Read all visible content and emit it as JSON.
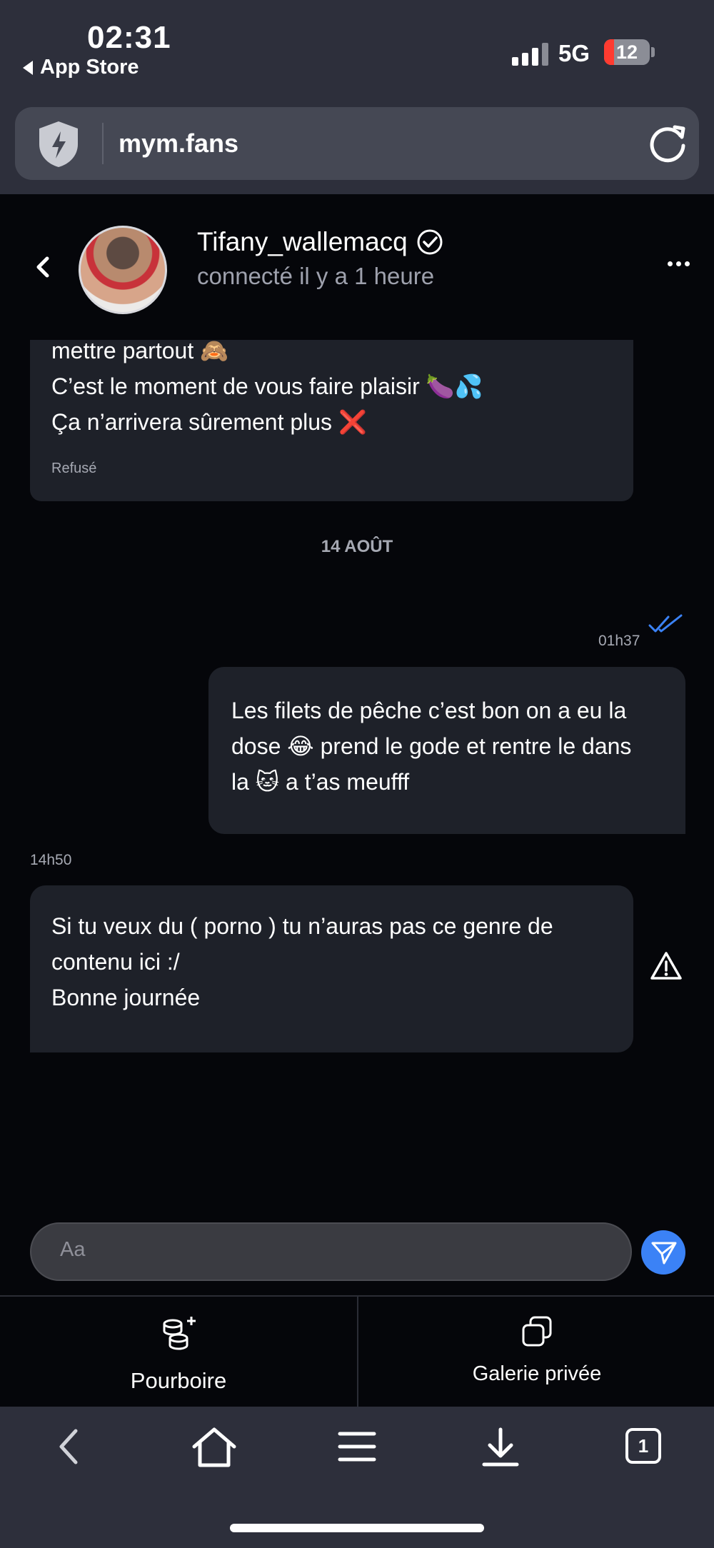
{
  "status_bar": {
    "time": "02:31",
    "back_app": "App Store",
    "network": "5G",
    "battery": "12",
    "battery_color": "#ff3b30"
  },
  "browser": {
    "url": "mym.fans",
    "icons": [
      "shield-icon",
      "reload-icon"
    ]
  },
  "chat": {
    "contact_name": "Tifany_wallemacq",
    "contact_status": "connecté il y a 1 heure",
    "verified": true,
    "messages": {
      "prev": {
        "line1": "mettre partout 🙈",
        "line2": "C’est le moment de vous faire plaisir 🍆💦",
        "line3": "Ça n’arrivera sûrement plus ❌",
        "label": "Refusé"
      },
      "date_separator": "14 AOÛT",
      "outgoing": {
        "time": "01h37",
        "line1": "Les filets de pêche c’est bon on a eu la",
        "line2": "dose 😂 prend le gode et rentre le dans",
        "line3": "la 🐱 a t’as meufff",
        "read_color": "#3b82f6"
      },
      "incoming": {
        "time": "14h50",
        "line1": "Si tu veux du ( porno ) tu n’auras pas ce genre de",
        "line2": "contenu ici :/",
        "line3": "Bonne journée"
      }
    },
    "composer": {
      "placeholder": "Aa",
      "send_color": "#3b82f6"
    }
  },
  "actions": {
    "tip_label": "Pourboire",
    "gallery_label": "Galerie privée"
  },
  "toolbar": {
    "tabs_count": "1",
    "icons": [
      "back-icon",
      "home-icon",
      "menu-icon",
      "download-icon",
      "tabs-icon"
    ]
  }
}
